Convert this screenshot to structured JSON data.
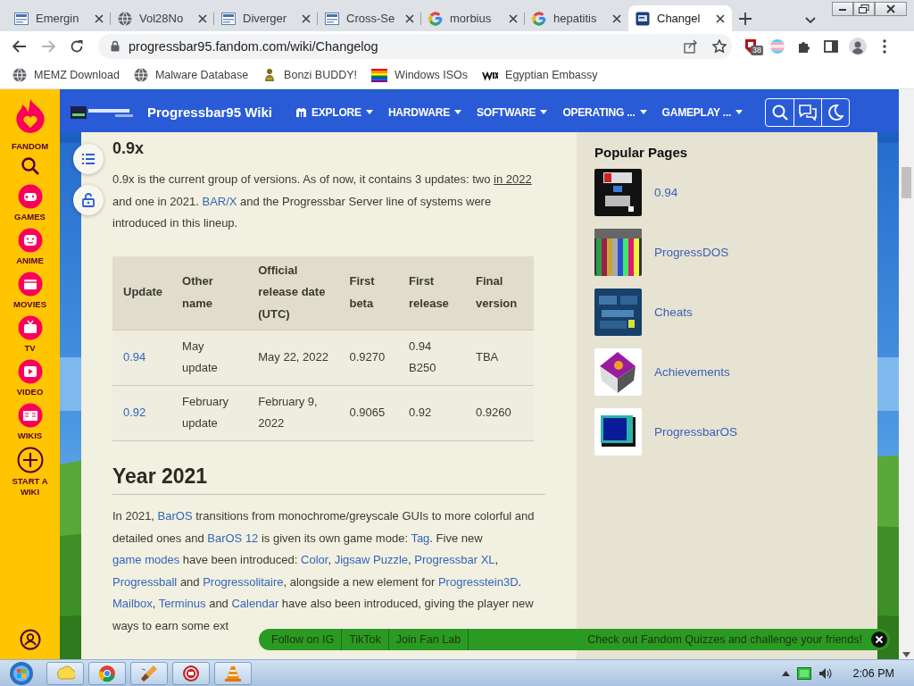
{
  "browser": {
    "tabs": [
      {
        "title": "Emergin",
        "kind": "doc",
        "selected": false
      },
      {
        "title": "Vol28No",
        "kind": "globe",
        "selected": false
      },
      {
        "title": "Diverger",
        "kind": "doc",
        "selected": false
      },
      {
        "title": "Cross-Se",
        "kind": "doc",
        "selected": false
      },
      {
        "title": "morbius",
        "kind": "google",
        "selected": false
      },
      {
        "title": "hepatitis",
        "kind": "google",
        "selected": false
      },
      {
        "title": "Changel",
        "kind": "app",
        "selected": true
      }
    ],
    "url": "progressbar95.fandom.com/wiki/Changelog",
    "extension_badge": "38",
    "bookmarks": [
      {
        "label": "MEMZ Download",
        "kind": "globe"
      },
      {
        "label": "Malware Database",
        "kind": "globe"
      },
      {
        "label": "Bonzi BUDDY!",
        "kind": "figure"
      },
      {
        "label": "Windows ISOs",
        "kind": "flag"
      },
      {
        "label": "Egyptian Embassy",
        "kind": "wix"
      }
    ]
  },
  "fandom_rail": {
    "brand": "FANDOM",
    "items": [
      {
        "label": "GAMES"
      },
      {
        "label": "ANIME"
      },
      {
        "label": "MOVIES"
      },
      {
        "label": "TV"
      },
      {
        "label": "VIDEO"
      },
      {
        "label": "WIKIS"
      }
    ],
    "start_label": "START A WIKI"
  },
  "wiki_header": {
    "title": "Progressbar95 Wiki",
    "nav": [
      {
        "label": "EXPLORE",
        "kind": "explore"
      },
      {
        "label": "HARDWARE",
        "kind": "menu"
      },
      {
        "label": "SOFTWARE",
        "kind": "menu"
      },
      {
        "label": "OPERATING ...",
        "kind": "menu"
      },
      {
        "label": "GAMEPLAY ...",
        "kind": "menu"
      }
    ]
  },
  "article": {
    "blocks": [
      {
        "kind": "subheading",
        "text": "0.9x"
      },
      {
        "kind": "paragraph",
        "segments": [
          {
            "kind": "text",
            "text": "0.9x is the current group of versions. As of now, it contains 3 updates: two "
          },
          {
            "kind": "underline",
            "text": "in 2022"
          },
          {
            "kind": "text",
            "text": " and one in 2021. "
          },
          {
            "kind": "link",
            "text": "BAR/X"
          },
          {
            "kind": "text",
            "text": " and the Progressbar Server line of systems were introduced in this lineup."
          }
        ]
      },
      {
        "kind": "table",
        "columns": [
          "Update",
          "Other name",
          "Official release date (UTC)",
          "First beta",
          "First release",
          "Final version"
        ],
        "rows": [
          {
            "cells": [
              "0.94",
              "May update",
              "May 22, 2022",
              "0.9270",
              "0.94 B250",
              "TBA"
            ]
          },
          {
            "cells": [
              "0.92",
              "February update",
              "February 9, 2022",
              "0.9065",
              "0.92",
              "0.9260"
            ]
          }
        ]
      },
      {
        "kind": "heading",
        "text": "Year 2021"
      },
      {
        "kind": "paragraph",
        "segments": [
          {
            "kind": "text",
            "text": "In 2021, "
          },
          {
            "kind": "link",
            "text": "BarOS"
          },
          {
            "kind": "text",
            "text": " transitions from monochrome/greyscale GUIs to more colorful and detailed ones and "
          },
          {
            "kind": "link",
            "text": "BarOS 12"
          },
          {
            "kind": "text",
            "text": " is given its own game mode: "
          },
          {
            "kind": "link",
            "text": "Tag"
          },
          {
            "kind": "text",
            "text": ". Five new "
          },
          {
            "kind": "link",
            "text": "game modes"
          },
          {
            "kind": "text",
            "text": " have been introduced: "
          },
          {
            "kind": "link",
            "text": "Color"
          },
          {
            "kind": "text",
            "text": ", "
          },
          {
            "kind": "link",
            "text": "Jigsaw Puzzle"
          },
          {
            "kind": "text",
            "text": ", "
          },
          {
            "kind": "link",
            "text": "Progressbar XL"
          },
          {
            "kind": "text",
            "text": ", "
          },
          {
            "kind": "link",
            "text": "Progressball"
          },
          {
            "kind": "text",
            "text": " and "
          },
          {
            "kind": "link",
            "text": "Progressolitaire"
          },
          {
            "kind": "text",
            "text": ", alongside a new element for "
          },
          {
            "kind": "link",
            "text": "Progresstein3D"
          },
          {
            "kind": "text",
            "text": ". "
          },
          {
            "kind": "link",
            "text": "Mailbox"
          },
          {
            "kind": "text",
            "text": ", "
          },
          {
            "kind": "link",
            "text": "Terminus"
          },
          {
            "kind": "text",
            "text": " and "
          },
          {
            "kind": "link",
            "text": "Calendar"
          },
          {
            "kind": "text",
            "text": " have also been introduced, giving the player new ways to earn some ext"
          }
        ]
      }
    ]
  },
  "sidebar": {
    "title": "Popular Pages",
    "items": [
      {
        "label": "0.94"
      },
      {
        "label": "ProgressDOS"
      },
      {
        "label": "Cheats"
      },
      {
        "label": "Achievements"
      },
      {
        "label": "ProgressbarOS"
      }
    ]
  },
  "promo_bar": {
    "links": [
      "Follow on IG",
      "TikTok",
      "Join Fan Lab"
    ],
    "message": "Check out Fandom Quizzes and challenge your friends!"
  },
  "taskbar": {
    "clock": "2:06 PM"
  }
}
